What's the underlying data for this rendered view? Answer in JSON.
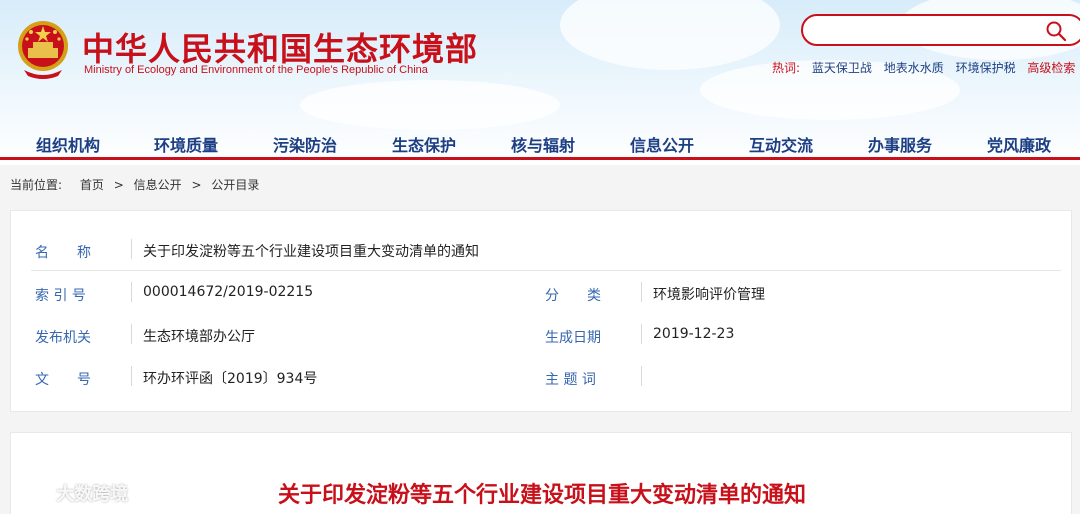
{
  "site": {
    "title_cn": "中华人民共和国生态环境部",
    "title_en": "Ministry of Ecology and Environment of the People's Republic of China",
    "emblem_icon": "national-emblem-icon"
  },
  "search": {
    "placeholder": "",
    "icon": "search-icon"
  },
  "hotwords": {
    "label": "热词:",
    "items": [
      "蓝天保卫战",
      "地表水水质",
      "环境保护税"
    ],
    "advanced": "高级检索"
  },
  "nav": {
    "items": [
      "组织机构",
      "环境质量",
      "污染防治",
      "生态保护",
      "核与辐射",
      "信息公开",
      "互动交流",
      "办事服务",
      "党风廉政"
    ]
  },
  "breadcrumb": {
    "label": "当前位置:",
    "items": [
      "首页",
      "信息公开",
      "公开目录"
    ],
    "separator": ">"
  },
  "info": {
    "name_label": "名　　称",
    "name_value": "关于印发淀粉等五个行业建设项目重大变动清单的通知",
    "index_label": "索 引 号",
    "index_value": "000014672/2019-02215",
    "category_label": "分　　类",
    "category_value": "环境影响评价管理",
    "issuer_label": "发布机关",
    "issuer_value": "生态环境部办公厅",
    "date_label": "生成日期",
    "date_value": "2019-12-23",
    "docno_label": "文　　号",
    "docno_value": "环办环评函〔2019〕934号",
    "subject_label": "主 题 词",
    "subject_value": ""
  },
  "document": {
    "title": "关于印发淀粉等五个行业建设项目重大变动清单的通知"
  },
  "watermark": {
    "text": "大数跨境"
  },
  "colors": {
    "brand_red": "#c8101a",
    "nav_blue": "#1c3f84",
    "label_blue": "#3667b0"
  }
}
